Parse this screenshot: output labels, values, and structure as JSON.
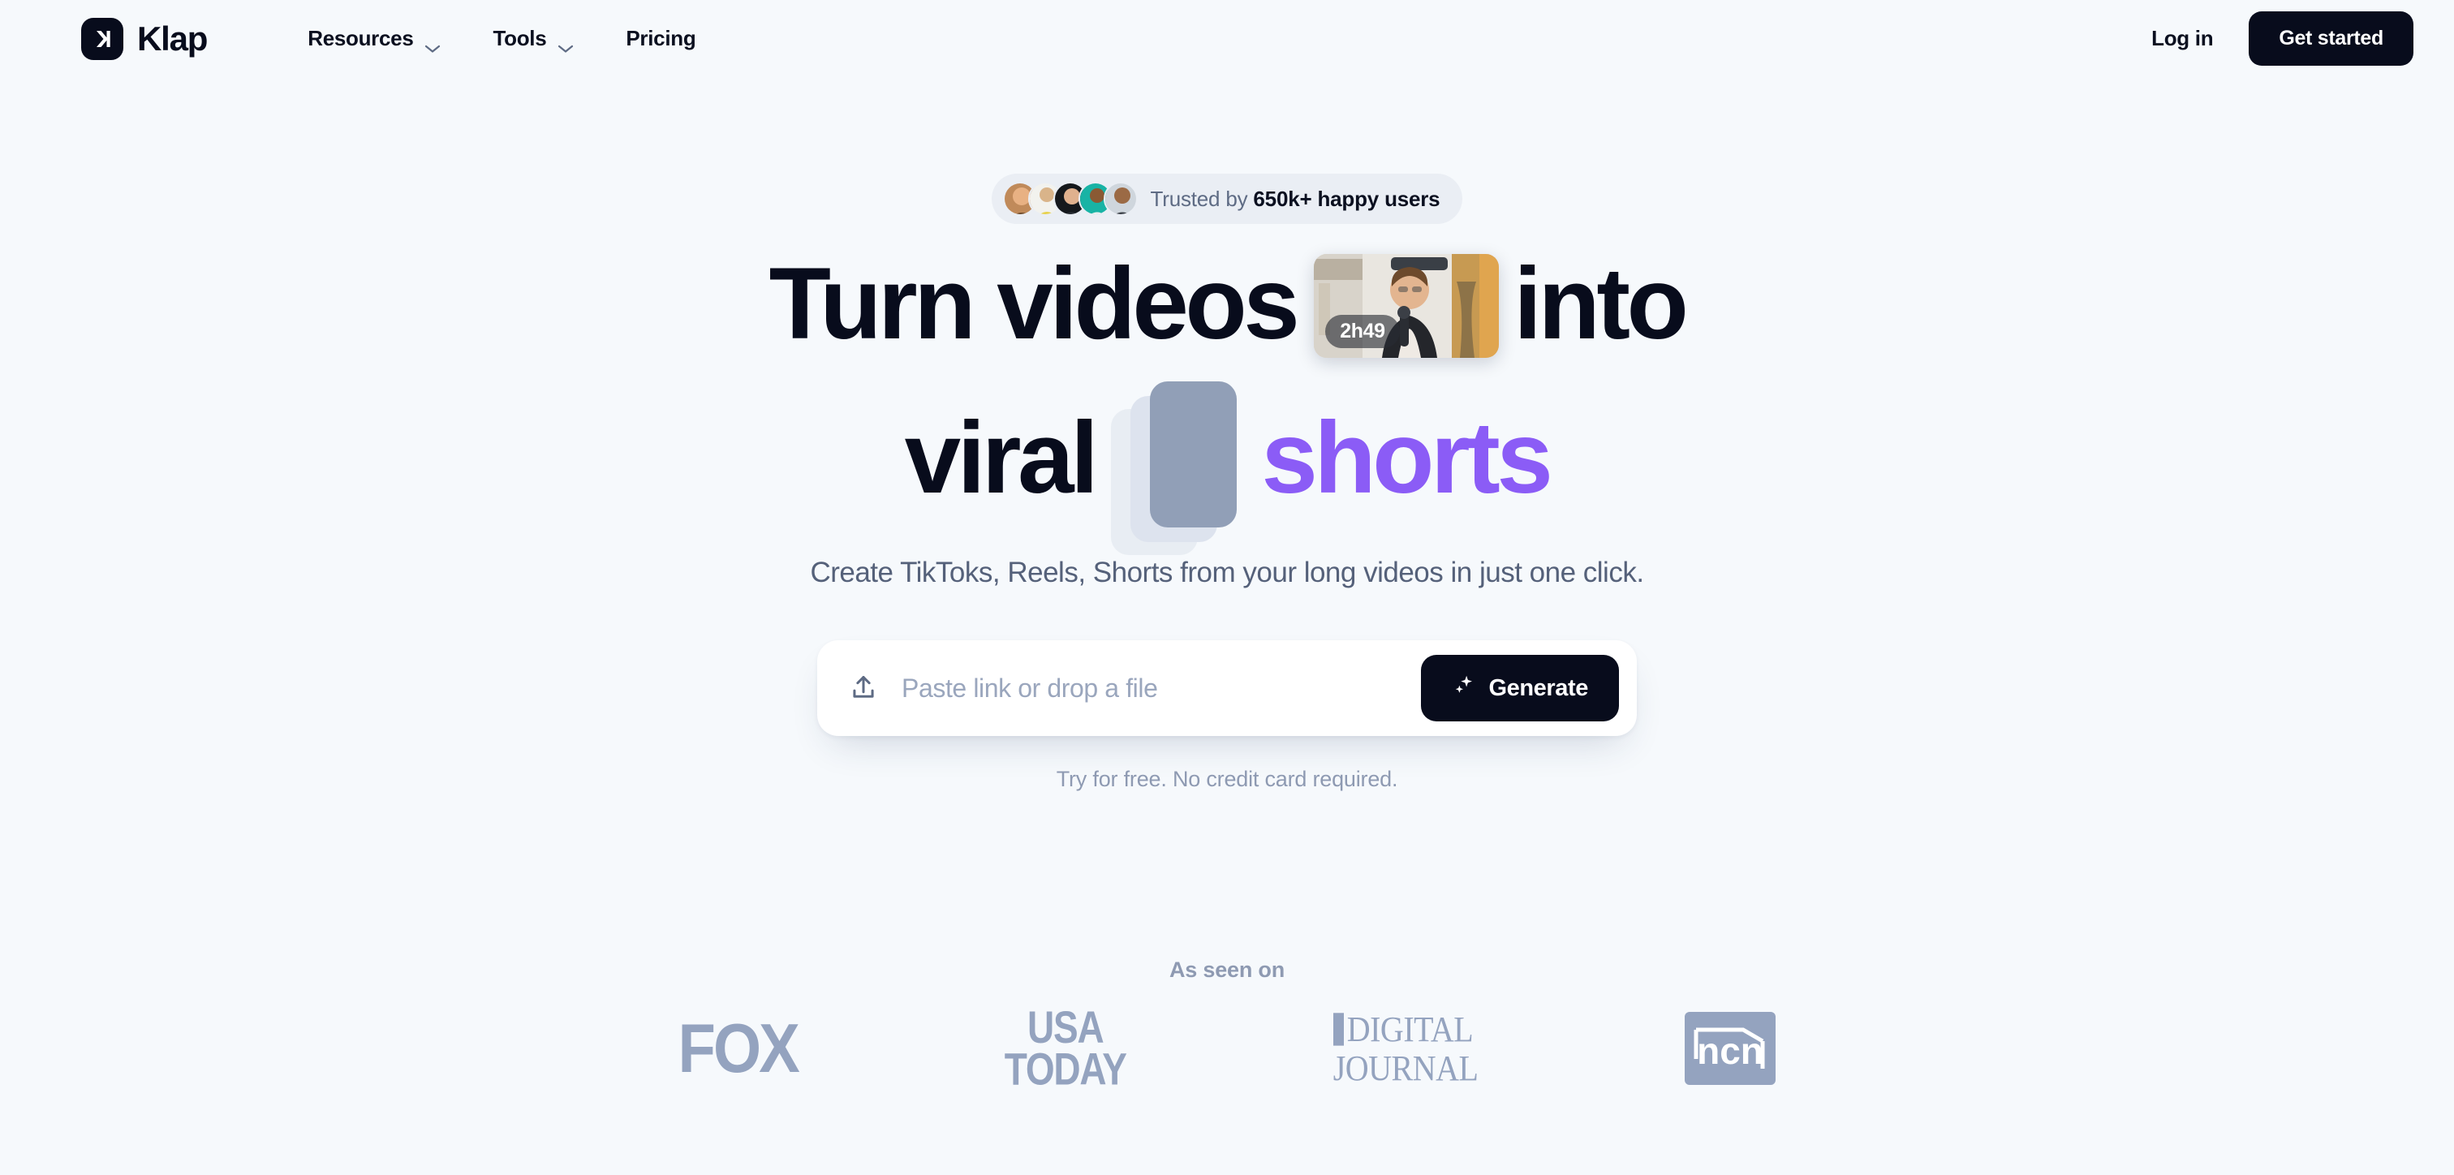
{
  "brand": {
    "name": "Klap",
    "logo_icon": "klap-mark-icon"
  },
  "nav": {
    "items": [
      {
        "label": "Resources",
        "has_dropdown": true,
        "icon": "chevron-down-icon"
      },
      {
        "label": "Tools",
        "has_dropdown": true,
        "icon": "chevron-down-icon"
      },
      {
        "label": "Pricing",
        "has_dropdown": false
      }
    ],
    "login_label": "Log in",
    "cta_label": "Get started"
  },
  "hero": {
    "trust": {
      "prefix": "Trusted by ",
      "highlight": "650k+",
      "suffix": " happy users",
      "avatar_count": 5
    },
    "headline": {
      "line1_a": "Turn videos",
      "line1_b": "into",
      "line2_a": "viral",
      "line2_b": "shorts",
      "highlight_color": "#8b5cf6",
      "text_color": "#080c1c"
    },
    "thumbnail": {
      "duration": "2h49",
      "alt": "video-thumbnail"
    },
    "subtitle": "Create TikToks, Reels, Shorts from your long videos in just one click.",
    "input": {
      "placeholder": "Paste link or drop a file",
      "value": "",
      "upload_icon": "upload-icon"
    },
    "generate": {
      "label": "Generate",
      "icon": "sparkle-icon"
    },
    "fineprint": "Try for free. No credit card required."
  },
  "as_seen_on": {
    "label": "As seen on",
    "logos": [
      {
        "name": "fox",
        "text": "FOX"
      },
      {
        "name": "usa-today",
        "line1": "USA",
        "line2": "TODAY"
      },
      {
        "name": "digital-journal",
        "line1": "DIGITAL",
        "line2": "JOURNAL"
      },
      {
        "name": "ncn",
        "text": "ncn"
      }
    ],
    "logo_color": "#94a3bf"
  },
  "theme": {
    "background": "#f6f9fc",
    "dark": "#080c1c",
    "accent": "#8b5cf6",
    "muted_text": "#8e9ab2"
  }
}
